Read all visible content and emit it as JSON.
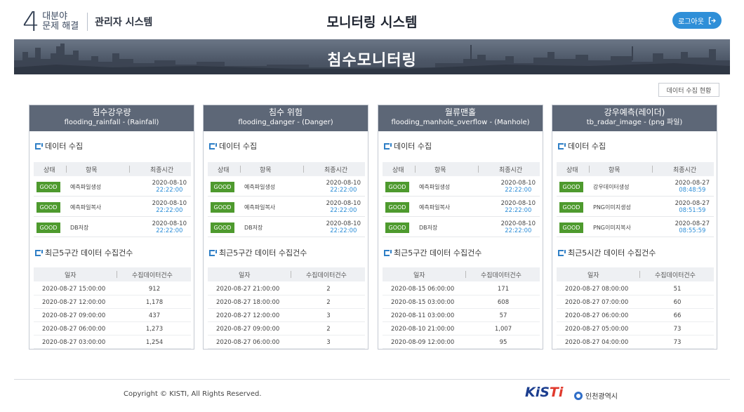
{
  "header": {
    "logo_number": "4",
    "logo_line1": "대분야",
    "logo_line2": "문제 해결",
    "system_name": "관리자 시스템",
    "title": "모니터링 시스템",
    "logout_label": "로그아웃"
  },
  "banner": {
    "title": "침수모니터링"
  },
  "collect_status_label": "데이터 수집 현황",
  "colors": {
    "accent": "#2f8fd8",
    "good": "#4e9a2e",
    "card_header": "#5d6777"
  },
  "cards": [
    {
      "title_kr": "침수강우량",
      "title_en": "flooding_rainfall - (Rainfall)",
      "collect_title": "데이터 수집",
      "status_headers": [
        "상태",
        "항목",
        "최종시간"
      ],
      "status_rows": [
        {
          "status": "GOOD",
          "item": "예측파일생성",
          "date": "2020-08-10",
          "time": "22:22:00"
        },
        {
          "status": "GOOD",
          "item": "예측파일복사",
          "date": "2020-08-10",
          "time": "22:22:00"
        },
        {
          "status": "GOOD",
          "item": "DB저장",
          "date": "2020-08-10",
          "time": "22:22:00"
        }
      ],
      "count_title": "최근5구간 데이터 수집건수",
      "count_headers": [
        "일자",
        "수집데이터건수"
      ],
      "count_rows": [
        {
          "date": "2020-08-27 15:00:00",
          "count": "912"
        },
        {
          "date": "2020-08-27 12:00:00",
          "count": "1,178"
        },
        {
          "date": "2020-08-27 09:00:00",
          "count": "437"
        },
        {
          "date": "2020-08-27 06:00:00",
          "count": "1,273"
        },
        {
          "date": "2020-08-27 03:00:00",
          "count": "1,254"
        }
      ]
    },
    {
      "title_kr": "침수 위험",
      "title_en": "flooding_danger - (Danger)",
      "collect_title": "데이터 수집",
      "status_headers": [
        "상태",
        "항목",
        "최종시간"
      ],
      "status_rows": [
        {
          "status": "GOOD",
          "item": "예측파일생성",
          "date": "2020-08-10",
          "time": "22:22:00"
        },
        {
          "status": "GOOD",
          "item": "예측파일복사",
          "date": "2020-08-10",
          "time": "22:22:00"
        },
        {
          "status": "GOOD",
          "item": "DB저장",
          "date": "2020-08-10",
          "time": "22:22:00"
        }
      ],
      "count_title": "최근5구간 데이터 수집건수",
      "count_headers": [
        "일자",
        "수집데이터건수"
      ],
      "count_rows": [
        {
          "date": "2020-08-27 21:00:00",
          "count": "2"
        },
        {
          "date": "2020-08-27 18:00:00",
          "count": "2"
        },
        {
          "date": "2020-08-27 12:00:00",
          "count": "3"
        },
        {
          "date": "2020-08-27 09:00:00",
          "count": "2"
        },
        {
          "date": "2020-08-27 06:00:00",
          "count": "3"
        }
      ]
    },
    {
      "title_kr": "월류맨홀",
      "title_en": "flooding_manhole_overflow - (Manhole)",
      "collect_title": "데이터 수집",
      "status_headers": [
        "상태",
        "항목",
        "최종시간"
      ],
      "status_rows": [
        {
          "status": "GOOD",
          "item": "예측파일생성",
          "date": "2020-08-10",
          "time": "22:22:00"
        },
        {
          "status": "GOOD",
          "item": "예측파일복사",
          "date": "2020-08-10",
          "time": "22:22:00"
        },
        {
          "status": "GOOD",
          "item": "DB저장",
          "date": "2020-08-10",
          "time": "22:22:00"
        }
      ],
      "count_title": "최근5구간 데이터 수집건수",
      "count_headers": [
        "일자",
        "수집데이터건수"
      ],
      "count_rows": [
        {
          "date": "2020-08-15 06:00:00",
          "count": "171"
        },
        {
          "date": "2020-08-15 03:00:00",
          "count": "608"
        },
        {
          "date": "2020-08-11 03:00:00",
          "count": "57"
        },
        {
          "date": "2020-08-10 21:00:00",
          "count": "1,007"
        },
        {
          "date": "2020-08-09 12:00:00",
          "count": "95"
        }
      ]
    },
    {
      "title_kr": "강우예측(레이더)",
      "title_en": "tb_radar_image - (png 파일)",
      "collect_title": "데이터 수집",
      "status_headers": [
        "상태",
        "항목",
        "최종시간"
      ],
      "status_rows": [
        {
          "status": "GOOD",
          "item": "강우데이터생성",
          "date": "2020-08-27",
          "time": "08:48:59"
        },
        {
          "status": "GOOD",
          "item": "PNG이미지생성",
          "date": "2020-08-27",
          "time": "08:51:59"
        },
        {
          "status": "GOOD",
          "item": "PNG이미지복사",
          "date": "2020-08-27",
          "time": "08:55:59"
        }
      ],
      "count_title": "최근5시간 데이터 수집건수",
      "count_headers": [
        "일자",
        "수집데이터건수"
      ],
      "count_rows": [
        {
          "date": "2020-08-27 08:00:00",
          "count": "51"
        },
        {
          "date": "2020-08-27 07:00:00",
          "count": "60"
        },
        {
          "date": "2020-08-27 06:00:00",
          "count": "66"
        },
        {
          "date": "2020-08-27 05:00:00",
          "count": "73"
        },
        {
          "date": "2020-08-27 04:00:00",
          "count": "73"
        }
      ]
    }
  ],
  "footer": {
    "copyright": "Copyright © KISTI, All Rights Reserved.",
    "kisti_logo_k": "KiS",
    "kisti_logo_t": "Ti",
    "incheon_label": "인천광역시"
  }
}
